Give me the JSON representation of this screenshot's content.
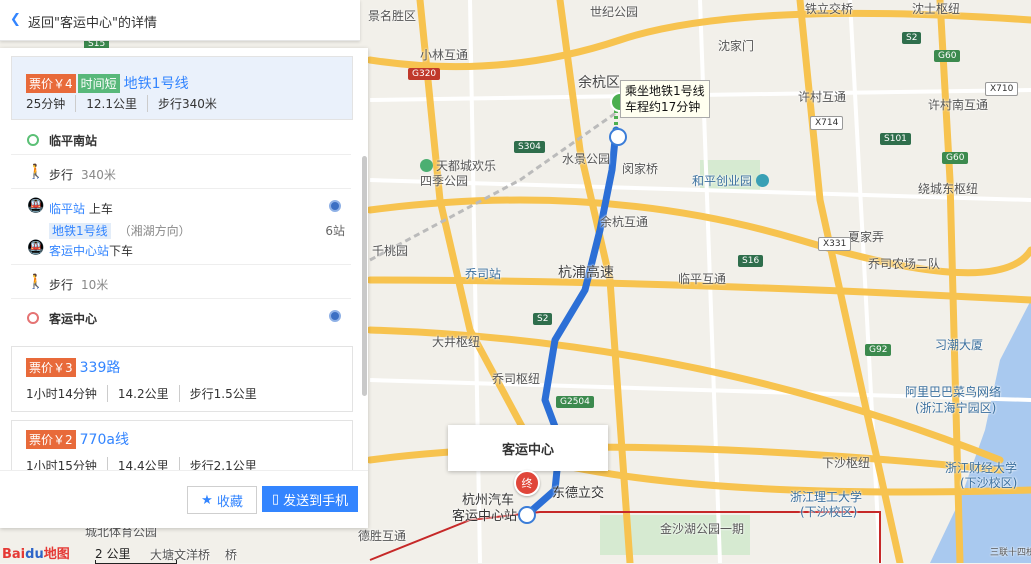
{
  "back": {
    "label": "返回\"客运中心\"的详情"
  },
  "routes": [
    {
      "price": "票价￥4",
      "time_tag": "时间短",
      "name": "地铁1号线",
      "duration": "25分钟",
      "distance": "12.1公里",
      "walk": "步行340米"
    },
    {
      "price": "票价￥3",
      "name": "339路",
      "duration": "1小时14分钟",
      "distance": "14.2公里",
      "walk": "步行1.5公里"
    },
    {
      "price": "票价￥2",
      "name": "770a线",
      "duration": "1小时15分钟",
      "distance": "14.4公里",
      "walk": "步行2.1公里"
    }
  ],
  "steps": {
    "origin": "临平南站",
    "walk1_label": "步行",
    "walk1_dist": "340米",
    "board_station": "临平站",
    "board_action": "上车",
    "line_name": "地铁1号线",
    "direction": "（湘湖方向）",
    "stops": "6站",
    "alight_station": "客运中心站",
    "alight_action": "下车",
    "walk2_label": "步行",
    "walk2_dist": "10米",
    "dest": "客运中心"
  },
  "buttons": {
    "favorite": "收藏",
    "send": "发送到手机"
  },
  "map": {
    "callout_line1": "乘坐地铁1号线",
    "callout_line2": "车程约17分钟",
    "dest_box": "客运中心",
    "end_marker": "终",
    "scale": "2 公里",
    "logo_part1": "Bai",
    "logo_part2": "du",
    "logo_part3": "地图",
    "labels": [
      {
        "t": "景名胜区"
      },
      {
        "t": "世纪公园"
      },
      {
        "t": "铁立交桥"
      },
      {
        "t": "沈士枢纽"
      },
      {
        "t": "小林互通"
      },
      {
        "t": "沈家门"
      },
      {
        "t": "余杭区"
      },
      {
        "t": "许村互通"
      },
      {
        "t": "许村南互通"
      },
      {
        "t": "天都城欢乐"
      },
      {
        "t": "四季公园"
      },
      {
        "t": "水景公园"
      },
      {
        "t": "闵家桥"
      },
      {
        "t": "和平创业园"
      },
      {
        "t": "绕城东枢纽"
      },
      {
        "t": "余杭互通"
      },
      {
        "t": "千桃园"
      },
      {
        "t": "夏家弄"
      },
      {
        "t": "乔司站"
      },
      {
        "t": "杭浦高速"
      },
      {
        "t": "临平互通"
      },
      {
        "t": "乔司农场二队"
      },
      {
        "t": "大井枢纽"
      },
      {
        "t": "习潮大厦"
      },
      {
        "t": "乔司枢纽"
      },
      {
        "t": "阿里巴巴菜鸟网络"
      },
      {
        "t": "(浙江海宁园区)"
      },
      {
        "t": "下沙枢纽"
      },
      {
        "t": "浙江财经大学"
      },
      {
        "t": "(下沙校区)"
      },
      {
        "t": "浙江理工大学"
      },
      {
        "t": "(下沙校区)"
      },
      {
        "t": "杭州汽车"
      },
      {
        "t": "东德立交"
      },
      {
        "t": "客运中心站"
      },
      {
        "t": "金沙湖公园一期"
      },
      {
        "t": "城北体育公园"
      },
      {
        "t": "德胜互通"
      },
      {
        "t": "大塘文洋桥"
      },
      {
        "t": "桥"
      },
      {
        "t": "三联十四桥"
      }
    ],
    "shields": [
      "S15",
      "G320",
      "S304",
      "S2",
      "G60",
      "X710",
      "X714",
      "S101",
      "G60",
      "X331",
      "S16",
      "S2",
      "G92",
      "G2504"
    ]
  }
}
